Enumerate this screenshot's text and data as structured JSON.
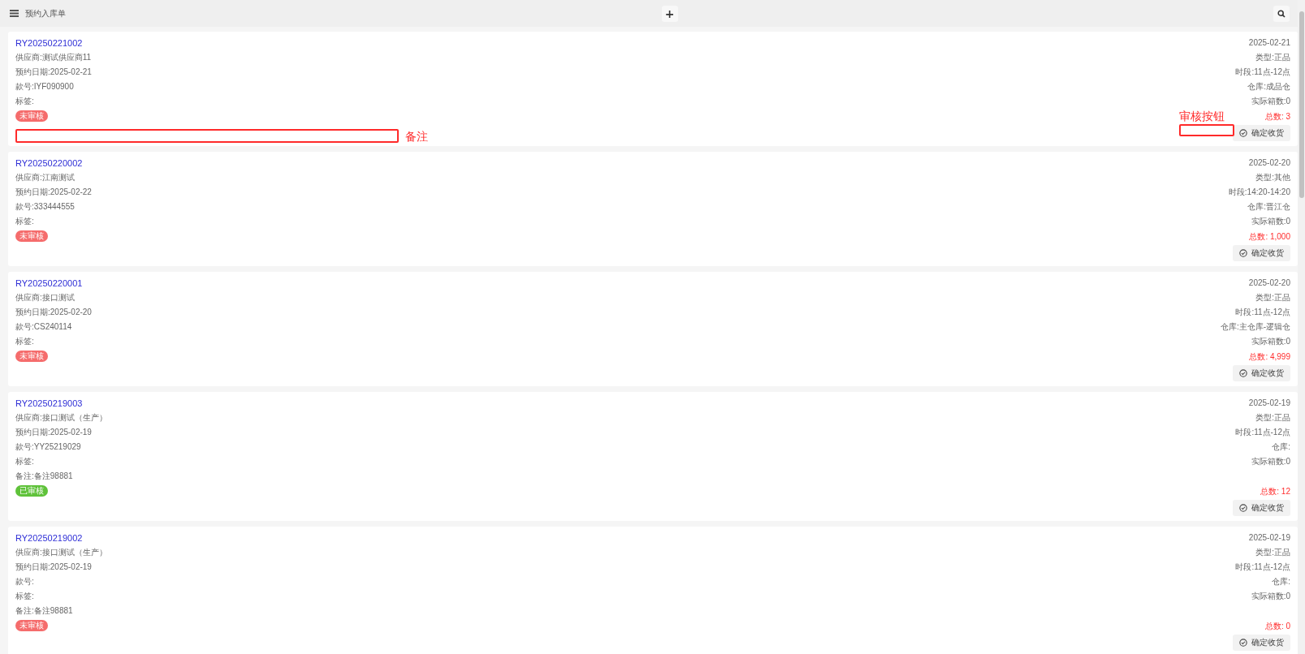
{
  "header": {
    "title": "预约入库单",
    "add_label": "+"
  },
  "cards": [
    {
      "id": "RY20250221002",
      "left": [
        "供应商:测试供应商11",
        "预约日期:2025-02-21",
        "款号:IYF090900",
        "标签:"
      ],
      "status": {
        "text": "未审核",
        "kind": "pending"
      },
      "date": "2025-02-21",
      "right": [
        "类型:正品",
        "时段:11点-12点",
        "仓库:成品仓",
        "实际箱数:0"
      ],
      "total": "总数: 3",
      "button": "确定收货",
      "annotations": {
        "remark": "备注",
        "button": "审核按钮"
      }
    },
    {
      "id": "RY20250220002",
      "left": [
        "供应商:江南测试",
        "预约日期:2025-02-22",
        "款号:333444555",
        "标签:"
      ],
      "status": {
        "text": "未审核",
        "kind": "pending"
      },
      "date": "2025-02-20",
      "right": [
        "类型:其他",
        "时段:14:20-14:20",
        "仓库:晋江仓",
        "实际箱数:0"
      ],
      "total": "总数: 1,000",
      "button": "确定收货"
    },
    {
      "id": "RY20250220001",
      "left": [
        "供应商:接口测试",
        "预约日期:2025-02-20",
        "款号:CS240114",
        "标签:"
      ],
      "status": {
        "text": "未审核",
        "kind": "pending"
      },
      "date": "2025-02-20",
      "right": [
        "类型:正品",
        "时段:11点-12点",
        "仓库:主仓库-逻辑仓",
        "实际箱数:0"
      ],
      "total": "总数: 4,999",
      "button": "确定收货"
    },
    {
      "id": "RY20250219003",
      "left": [
        "供应商:接口测试（生产）",
        "预约日期:2025-02-19",
        "款号:YY25219029",
        "标签:",
        "备注:备注98881"
      ],
      "status": {
        "text": "已审核",
        "kind": "approved"
      },
      "date": "2025-02-19",
      "right": [
        "类型:正品",
        "时段:11点-12点",
        "仓库:",
        "实际箱数:0"
      ],
      "total": "总数: 12",
      "button": "确定收货"
    },
    {
      "id": "RY20250219002",
      "left": [
        "供应商:接口测试（生产）",
        "预约日期:2025-02-19",
        "款号:",
        "标签:",
        "备注:备注98881"
      ],
      "status": {
        "text": "未审核",
        "kind": "pending"
      },
      "date": "2025-02-19",
      "right": [
        "类型:正品",
        "时段:11点-12点",
        "仓库:",
        "实际箱数:0"
      ],
      "total": "总数: 0",
      "button": "确定收货"
    }
  ]
}
